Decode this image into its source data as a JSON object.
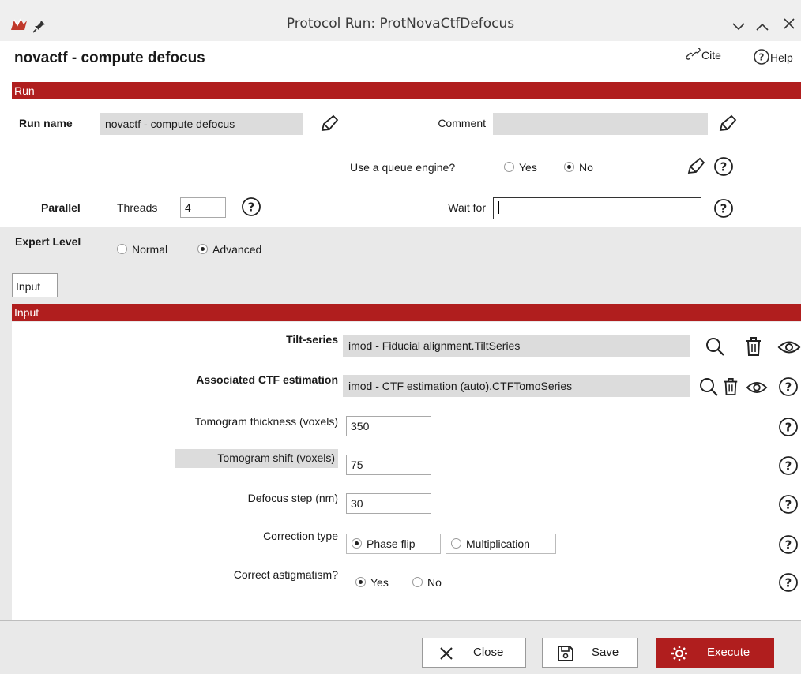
{
  "window": {
    "title": "Protocol Run: ProtNovaCtfDefocus"
  },
  "header": {
    "protocol_title": "novactf - compute defocus",
    "cite_label": "Cite",
    "help_label": "Help"
  },
  "run_section": {
    "bar_label": "Run",
    "run_name_label": "Run name",
    "run_name_value": "novactf - compute defocus",
    "comment_label": "Comment",
    "comment_value": "",
    "queue_label": "Use a queue engine?",
    "queue_yes": "Yes",
    "queue_no": "No",
    "queue_selected": "No",
    "parallel_label": "Parallel",
    "threads_label": "Threads",
    "threads_value": "4",
    "wait_for_label": "Wait for",
    "wait_for_value": ""
  },
  "expert": {
    "label": "Expert Level",
    "normal": "Normal",
    "advanced": "Advanced",
    "selected": "Advanced"
  },
  "tabs": [
    {
      "label": "Input"
    }
  ],
  "input_section": {
    "bar_label": "Input",
    "tilt_series_label": "Tilt-series",
    "tilt_series_value": "imod - Fiducial alignment.TiltSeries",
    "ctf_label": "Associated CTF estimation",
    "ctf_value": "imod - CTF estimation (auto).CTFTomoSeries",
    "thickness_label": "Tomogram thickness (voxels)",
    "thickness_value": "350",
    "shift_label": "Tomogram shift (voxels)",
    "shift_value": "75",
    "defocus_step_label": "Defocus step (nm)",
    "defocus_step_value": "30",
    "correction_type_label": "Correction type",
    "correction_phase_flip": "Phase flip",
    "correction_multiplication": "Multiplication",
    "correction_selected": "Phase flip",
    "astig_label": "Correct astigmatism?",
    "astig_yes": "Yes",
    "astig_no": "No",
    "astig_selected": "Yes"
  },
  "footer": {
    "close_label": "Close",
    "save_label": "Save",
    "execute_label": "Execute"
  },
  "colors": {
    "accent_red": "#b01e1e",
    "field_gray": "#dcdcdc",
    "panel_gray": "#e9e9e9"
  }
}
